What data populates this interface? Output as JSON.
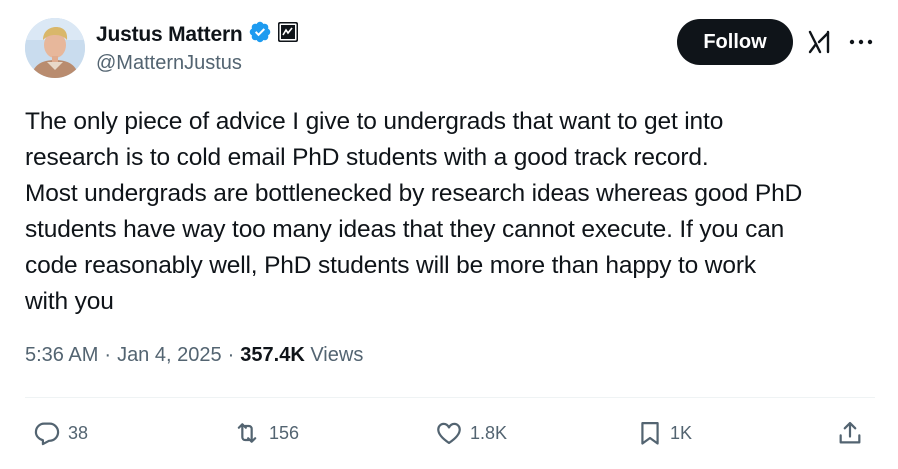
{
  "author": {
    "display_name": "Justus Mattern",
    "handle": "@MatternJustus",
    "verified_icon": "verified-badge-icon",
    "affiliate_icon": "affiliate-badge-icon"
  },
  "header": {
    "follow_label": "Follow",
    "grok_icon": "grok-icon",
    "more_icon": "more-options-icon"
  },
  "tweet": {
    "paragraphs": [
      "The only piece of advice I give to undergrads that want to get into\nresearch is to cold email PhD students with a good track record.",
      "Most undergrads are bottlenecked by research ideas whereas good PhD\nstudents have way too many ideas that they cannot execute. If you can\ncode reasonably well, PhD students will be more than happy to work\nwith you"
    ]
  },
  "meta": {
    "time": "5:36 AM",
    "separator": "·",
    "date": "Jan 4, 2025",
    "views_count": "357.4K",
    "views_label": "Views"
  },
  "actions": {
    "reply": {
      "icon": "reply-icon",
      "count": "38"
    },
    "retweet": {
      "icon": "retweet-icon",
      "count": "156"
    },
    "like": {
      "icon": "heart-icon",
      "count": "1.8K"
    },
    "bookmark": {
      "icon": "bookmark-icon",
      "count": "1K"
    },
    "share": {
      "icon": "share-icon"
    }
  },
  "colors": {
    "text_primary": "#0f1419",
    "text_secondary": "#536471",
    "verified_blue": "#1d9bf0",
    "follow_bg": "#0f1419"
  }
}
